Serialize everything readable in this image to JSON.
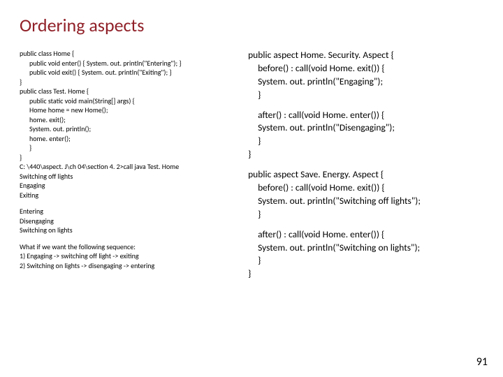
{
  "title": "Ordering aspects",
  "left": {
    "code1": {
      "l1": "public class Home {",
      "l2": "public void enter() {  System. out. println(\"Entering\");  }",
      "l3": "public void exit() { System. out. println(\"Exiting\"); }",
      "l4": "}",
      "l5": "public class Test. Home {",
      "l6": "public static void main(String[] args) {",
      "l7": "Home home = new Home();",
      "l8": "home. exit();",
      "l9": "System. out. println();",
      "l10": "home. enter();",
      "l11": "}",
      "l12": "}",
      "l13": "C: \\440\\aspect. J\\ch 04\\section 4. 2>call java Test. Home",
      "l14": "Switching off lights",
      "l15": "Engaging",
      "l16": "Exiting"
    },
    "out2": {
      "l1": "Entering",
      "l2": "Disengaging",
      "l3": "Switching on lights"
    },
    "note": {
      "l1": "What if we want the following sequence:",
      "l2": "1)  Engaging -> switching off light -> exiting",
      "l3": "2)  Switching on lights -> disengaging -> entering"
    }
  },
  "right": {
    "asp1": {
      "l1": "public aspect Home. Security. Aspect {",
      "l2": "before() : call(void Home. exit()) {",
      "l3": "System. out. println(\"Engaging\");",
      "l4": "}",
      "l5": "after() : call(void Home. enter()) {",
      "l6": "System. out. println(\"Disengaging\");",
      "l7": "}",
      "l8": "}"
    },
    "asp2": {
      "l1": "public aspect Save. Energy. Aspect {",
      "l2": "before() : call(void Home. exit()) {",
      "l3": "System. out. println(\"Switching off lights\");",
      "l4": "}",
      "l5": "after() : call(void Home. enter()) {",
      "l6": "System. out. println(\"Switching on lights\");",
      "l7": "}",
      "l8": "}"
    }
  },
  "page": "91"
}
